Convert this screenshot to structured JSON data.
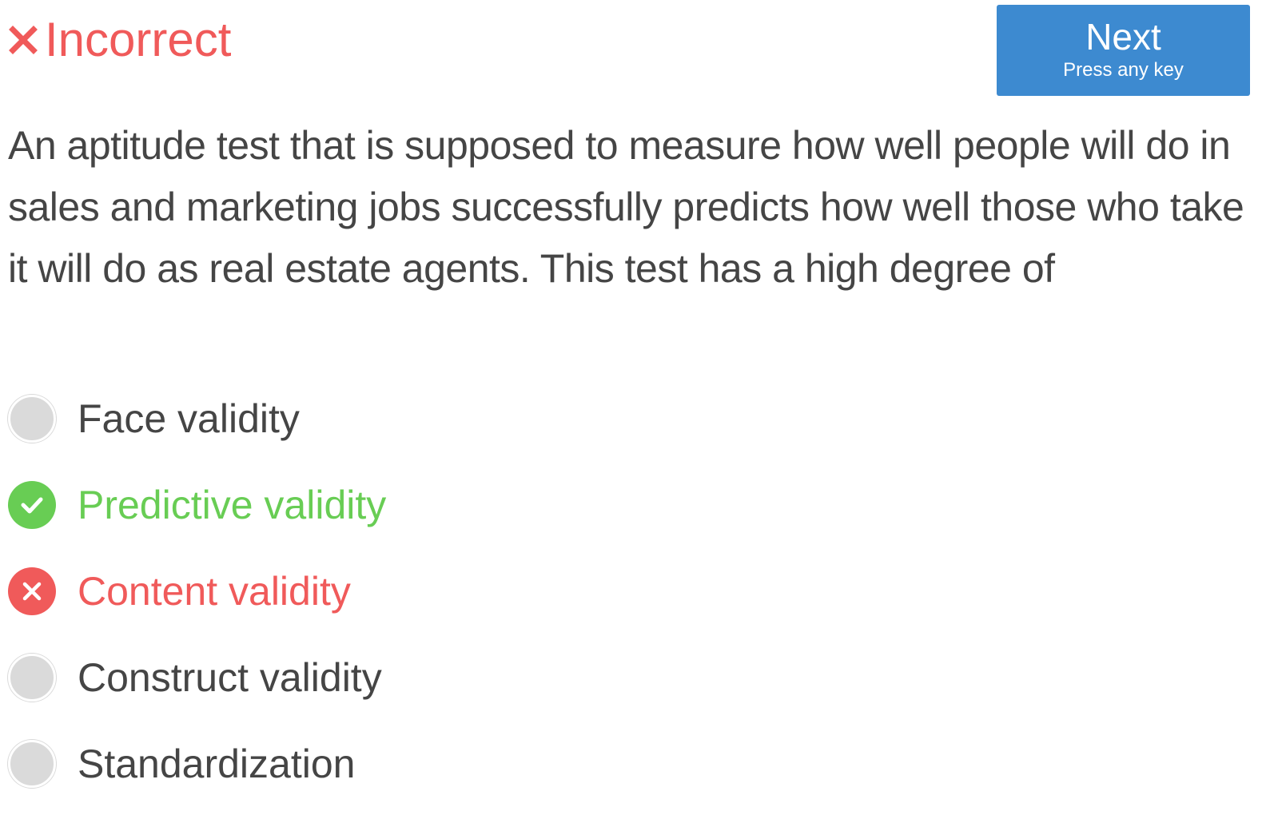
{
  "status": {
    "text": "Incorrect",
    "icon": "x-icon",
    "color": "#f05a5a"
  },
  "next_button": {
    "label": "Next",
    "hint": "Press any key",
    "color": "#3d8ad0"
  },
  "question": {
    "text": "An aptitude test that is supposed to measure how well people will do in sales and marketing jobs successfully predicts how well those who take it will do as real estate agents. This test has a high degree of"
  },
  "options": [
    {
      "label": "Face validity",
      "state": "unselected"
    },
    {
      "label": "Predictive validity",
      "state": "correct"
    },
    {
      "label": "Content validity",
      "state": "incorrect"
    },
    {
      "label": "Construct validity",
      "state": "unselected"
    },
    {
      "label": "Standardization",
      "state": "unselected"
    }
  ],
  "colors": {
    "text": "#454545",
    "correct": "#68cd54",
    "incorrect": "#f05a5a",
    "radio_unselected": "#dadada",
    "white": "#ffffff"
  },
  "icons": {
    "correct": "checkmark-icon",
    "incorrect": "x-icon",
    "unselected": "radio-empty-icon"
  }
}
